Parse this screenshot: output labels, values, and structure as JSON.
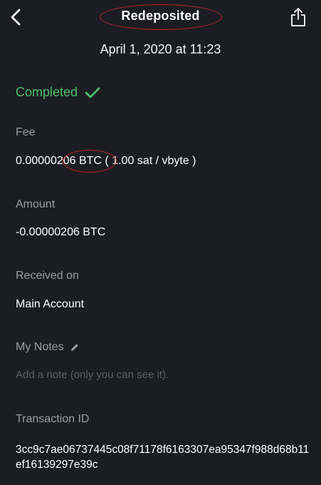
{
  "header": {
    "title": "Redeposited",
    "datetime": "April 1, 2020 at 11:23"
  },
  "status": {
    "text": "Completed",
    "color": "#4cc06a",
    "icon": "checkmark-icon"
  },
  "fee": {
    "label": "Fee",
    "amount": "0.00000206 BTC",
    "rate": " ( 1.00 sat / vbyte )"
  },
  "amount": {
    "label": "Amount",
    "value": "-0.00000206 BTC"
  },
  "received": {
    "label": "Received on",
    "value": "Main Account"
  },
  "notes": {
    "label": "My Notes",
    "placeholder": "Add a note (only you can see it).",
    "edit_icon": "pencil-icon"
  },
  "transaction": {
    "label": "Transaction ID",
    "id": "3cc9c7ae06737445c08f71178f6163307ea95347f988d68b11ef16139297e39c"
  },
  "annotation_color": "#c4252b"
}
